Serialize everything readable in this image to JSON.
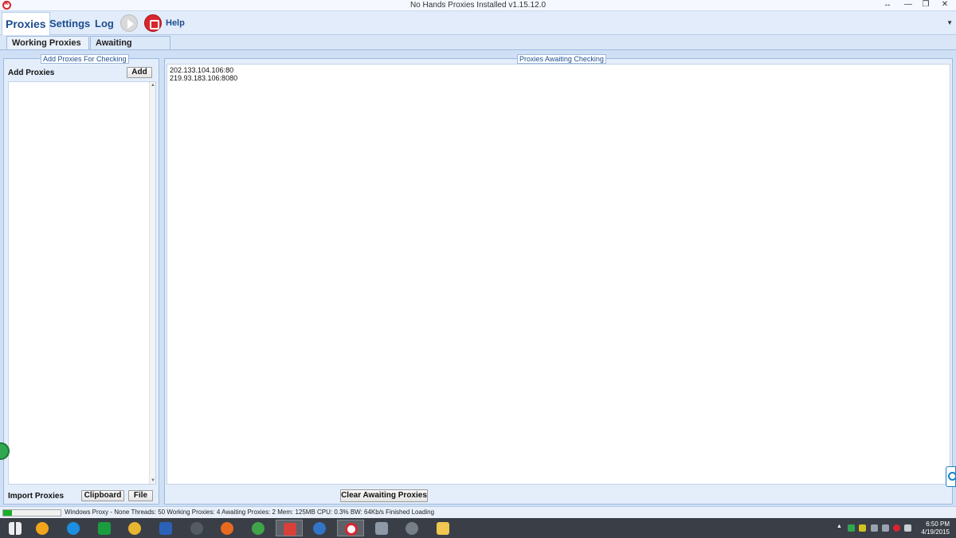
{
  "window": {
    "title": "No Hands Proxies Installed v1.15.12.0",
    "controls": [
      "↔",
      "—",
      "❐",
      "✕"
    ]
  },
  "menu": {
    "tabs": [
      "Proxies",
      "Settings",
      "Log"
    ],
    "active_tab": "Proxies",
    "play_icon": "play-icon",
    "stop_icon": "stop-icon",
    "help_label": "Help"
  },
  "subtabs": {
    "working": "Working Proxies",
    "awaiting": "Awaiting Proxies",
    "active": "Awaiting Proxies"
  },
  "left_panel": {
    "title": "Add Proxies For Checking",
    "add_label": "Add Proxies",
    "add_button": "Add",
    "import_label": "Import Proxies",
    "clipboard_button": "Clipboard",
    "file_button": "File"
  },
  "right_panel": {
    "title": "Proxies Awaiting Checking",
    "proxies": [
      "202.133.104.106:80",
      "219.93.183.106:8080"
    ],
    "clear_button": "Clear Awaiting Proxies"
  },
  "status": {
    "progress_fraction": 0.15,
    "text": "Windows Proxy - None  Threads: 50  Working Proxies: 4  Awaiting Proxies: 2  Mem: 125MB  CPU: 0.3%  BW: 64Kb/s  Finished Loading"
  },
  "taskbar": {
    "clock_time": "6:50 PM",
    "clock_date": "4/19/2015",
    "tray_caret": "▲",
    "colors": {
      "accent": "#1c4d8f",
      "stop": "#d7262e",
      "progress": "#18b02a"
    }
  }
}
